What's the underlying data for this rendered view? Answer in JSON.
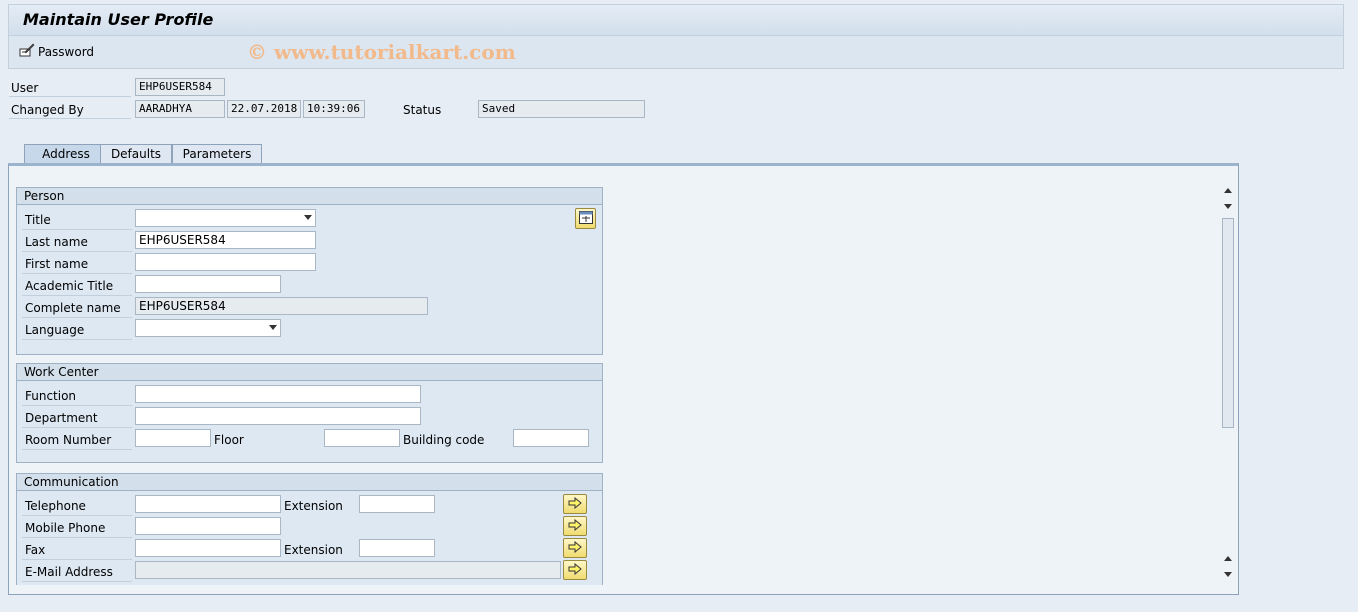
{
  "window": {
    "title": "Maintain User Profile"
  },
  "toolbar": {
    "password_label": "Password",
    "watermark": "© www.tutorialkart.com"
  },
  "header": {
    "user_label": "User",
    "user_value": "EHP6USER584",
    "changed_by_label": "Changed By",
    "changed_by_value": "AARADHYA",
    "changed_date": "22.07.2018",
    "changed_time": "10:39:06",
    "status_label": "Status",
    "status_value": "Saved"
  },
  "tabs": [
    {
      "label": "Address",
      "active": true
    },
    {
      "label": "Defaults",
      "active": false
    },
    {
      "label": "Parameters",
      "active": false
    }
  ],
  "person": {
    "heading": "Person",
    "title_label": "Title",
    "title_value": "",
    "last_name_label": "Last name",
    "last_name_value": "EHP6USER584",
    "first_name_label": "First name",
    "first_name_value": "",
    "academic_title_label": "Academic Title",
    "academic_title_value": "",
    "complete_name_label": "Complete name",
    "complete_name_value": "EHP6USER584",
    "language_label": "Language",
    "language_value": ""
  },
  "work_center": {
    "heading": "Work Center",
    "function_label": "Function",
    "function_value": "",
    "department_label": "Department",
    "department_value": "",
    "room_label": "Room Number",
    "room_value": "",
    "floor_label": "Floor",
    "floor_value": "",
    "building_label": "Building code",
    "building_value": ""
  },
  "communication": {
    "heading": "Communication",
    "telephone_label": "Telephone",
    "telephone_value": "",
    "tel_ext_label": "Extension",
    "tel_ext_value": "",
    "mobile_label": "Mobile Phone",
    "mobile_value": "",
    "fax_label": "Fax",
    "fax_value": "",
    "fax_ext_label": "Extension",
    "fax_ext_value": "",
    "email_label": "E-Mail Address",
    "email_value": ""
  },
  "colors": {
    "accent": "#f0dc70",
    "background": "#e6edf5",
    "group": "#dde8f3"
  },
  "icons": [
    "password-edit-icon",
    "expand-address-icon",
    "more-details-arrow-icon",
    "scroll-up-icon",
    "scroll-down-icon"
  ]
}
